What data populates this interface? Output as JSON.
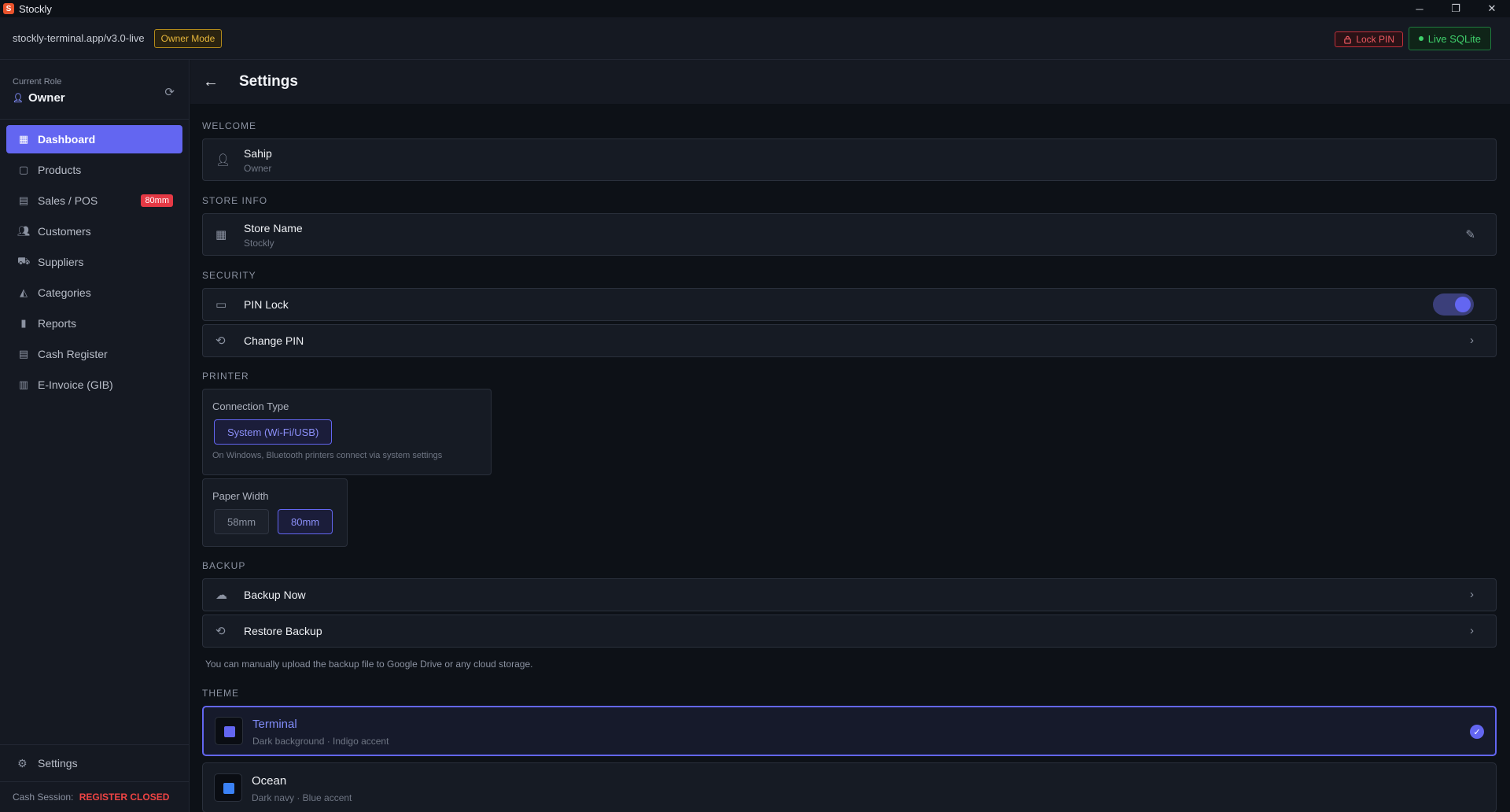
{
  "window": {
    "title": "Stockly",
    "logo": "S",
    "minimize": "─",
    "restore": "❐",
    "close": "✕"
  },
  "addressbar": {
    "url": "stockly-terminal.app/v3.0-live",
    "mode_badge": "Owner Mode",
    "lock_pin": "Lock PIN",
    "live_status": "Live SQLite"
  },
  "sidebar": {
    "role_label": "Current Role",
    "role_name": "Owner",
    "items": [
      {
        "label": "Dashboard",
        "icon": "dashboard-icon"
      },
      {
        "label": "Products",
        "icon": "box-icon"
      },
      {
        "label": "Sales / POS",
        "icon": "register-icon",
        "badge": "80mm"
      },
      {
        "label": "Customers",
        "icon": "users-icon"
      },
      {
        "label": "Suppliers",
        "icon": "truck-icon"
      },
      {
        "label": "Categories",
        "icon": "shapes-icon"
      },
      {
        "label": "Reports",
        "icon": "bar-chart-icon"
      },
      {
        "label": "Cash Register",
        "icon": "cash-register-icon"
      },
      {
        "label": "E-Invoice (GIB)",
        "icon": "invoice-icon"
      }
    ],
    "settings_label": "Settings",
    "cash_session_label": "Cash Session:",
    "cash_session_status": "REGISTER CLOSED"
  },
  "main": {
    "title": "Settings",
    "welcome": {
      "section": "WELCOME",
      "name": "Sahip",
      "role": "Owner"
    },
    "store": {
      "section": "STORE INFO",
      "title": "Store Name",
      "value": "Stockly"
    },
    "security": {
      "section": "SECURITY",
      "pin_lock": "PIN Lock",
      "pin_lock_enabled": true,
      "change_pin": "Change PIN"
    },
    "printer": {
      "section": "PRINTER",
      "connection_label": "Connection Type",
      "connection_value": "System (Wi-Fi/USB)",
      "connection_hint": "On Windows, Bluetooth printers connect via system settings",
      "paper_label": "Paper Width",
      "paper_options": [
        "58mm",
        "80mm"
      ],
      "paper_selected": "80mm"
    },
    "backup": {
      "section": "BACKUP",
      "backup_now": "Backup Now",
      "restore": "Restore Backup",
      "note": "You can manually upload the backup file to Google Drive or any cloud storage."
    },
    "theme": {
      "section": "THEME",
      "options": [
        {
          "name": "Terminal",
          "desc": "Dark background · Indigo accent",
          "color": "#6366f1",
          "selected": true
        },
        {
          "name": "Ocean",
          "desc": "Dark navy · Blue accent",
          "color": "#3b82f6",
          "selected": false
        }
      ]
    }
  }
}
